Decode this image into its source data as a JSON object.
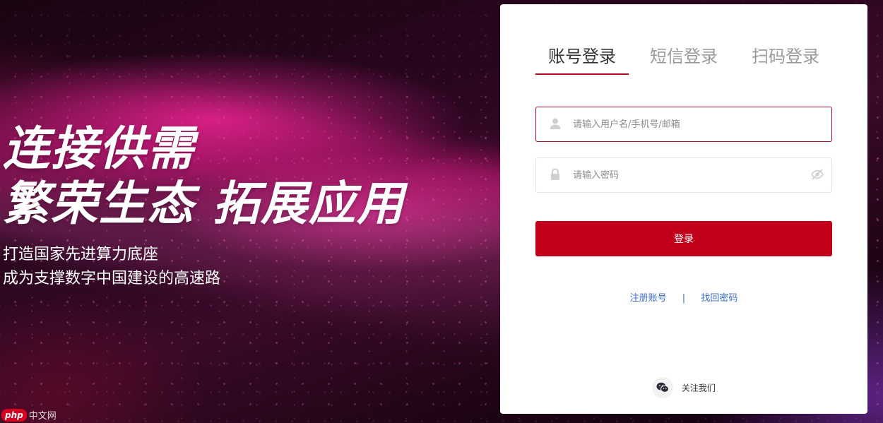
{
  "hero": {
    "headline_line1": "连接供需",
    "headline_line2": "繁荣生态 拓展应用",
    "subline1": "打造国家先进算力底座",
    "subline2": "成为支撑数字中国建设的高速路"
  },
  "login": {
    "tabs": [
      {
        "label": "账号登录",
        "active": true
      },
      {
        "label": "短信登录",
        "active": false
      },
      {
        "label": "扫码登录",
        "active": false
      }
    ],
    "username": {
      "placeholder": "请输入用户名/手机号/邮箱",
      "value": ""
    },
    "password": {
      "placeholder": "请输入密码",
      "value": ""
    },
    "submit_label": "登录",
    "register_link": "注册账号",
    "separator": "|",
    "recover_link": "找回密码",
    "follow_label": "关注我们"
  },
  "watermark": {
    "badge": "php",
    "text": "中文网"
  },
  "colors": {
    "accent": "#c2001b",
    "link": "#3a6ac8",
    "tab_underline": "#b0001a"
  },
  "icons": {
    "username": "user-icon",
    "password": "lock-icon",
    "toggle": "eye-hidden-icon",
    "follow": "wechat-icon"
  }
}
